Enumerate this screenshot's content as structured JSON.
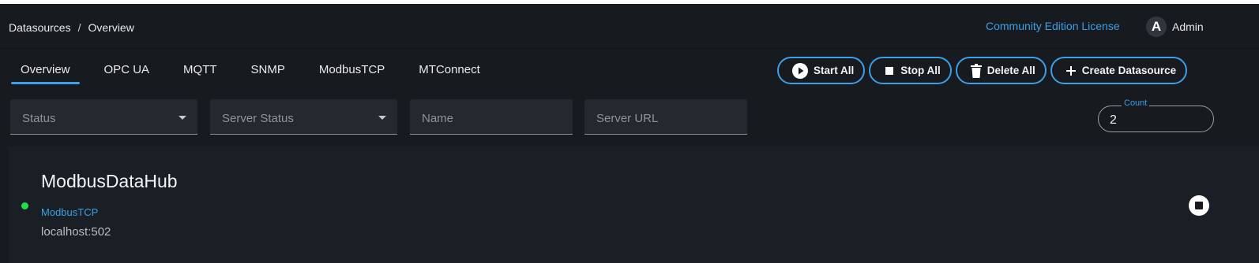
{
  "header": {
    "breadcrumb": [
      "Datasources",
      "Overview"
    ],
    "breadcrumb_separator": "/",
    "license_link": "Community Edition License",
    "user": {
      "avatar_letter": "A",
      "name": "Admin"
    }
  },
  "tabs": [
    {
      "label": "Overview",
      "active": true
    },
    {
      "label": "OPC UA"
    },
    {
      "label": "MQTT"
    },
    {
      "label": "SNMP"
    },
    {
      "label": "ModbusTCP"
    },
    {
      "label": "MTConnect"
    }
  ],
  "actions": [
    {
      "label": "Start All",
      "icon": "play-circle-icon"
    },
    {
      "label": "Stop All",
      "icon": "stop-square-icon"
    },
    {
      "label": "Delete All",
      "icon": "trash-icon"
    },
    {
      "label": "Create Datasource",
      "icon": "plus-icon"
    }
  ],
  "filters": {
    "status": {
      "placeholder": "Status"
    },
    "server_status": {
      "placeholder": "Server Status"
    },
    "name": {
      "placeholder": "Name"
    },
    "server_url": {
      "placeholder": "Server URL"
    },
    "count": {
      "label": "Count",
      "value": "2"
    }
  },
  "datasources": [
    {
      "name": "ModbusDataHub",
      "type": "ModbusTCP",
      "address": "localhost:502",
      "status_color": "#1be14c"
    }
  ],
  "colors": {
    "accent": "#3aa0e8",
    "background": "#171b20",
    "status_running": "#1be14c"
  }
}
